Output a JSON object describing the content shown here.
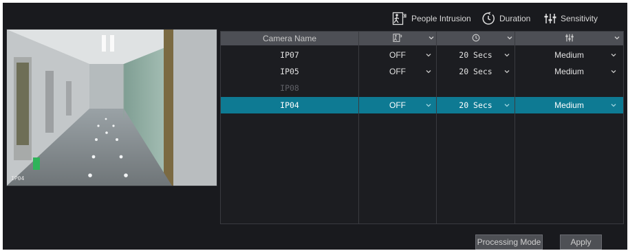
{
  "legend": {
    "intrusion_label": "People Intrusion",
    "duration_label": "Duration",
    "sensitivity_label": "Sensitivity"
  },
  "preview": {
    "camera_tag": "IP04"
  },
  "table": {
    "camera_header": "Camera Name",
    "rows": [
      {
        "camera": "IP07",
        "intrusion": "OFF",
        "duration": "20 Secs",
        "sensitivity": "Medium",
        "state": "normal"
      },
      {
        "camera": "IP05",
        "intrusion": "OFF",
        "duration": "20 Secs",
        "sensitivity": "Medium",
        "state": "normal"
      },
      {
        "camera": "IP08",
        "intrusion": "",
        "duration": "",
        "sensitivity": "",
        "state": "disabled"
      },
      {
        "camera": "IP04",
        "intrusion": "OFF",
        "duration": "20 Secs",
        "sensitivity": "Medium",
        "state": "selected"
      }
    ]
  },
  "buttons": {
    "processing_mode": "Processing Mode",
    "apply": "Apply"
  },
  "colors": {
    "background": "#191a1e",
    "header": "#4d4f55",
    "selected_row": "#0e7a93",
    "button": "#4e5055"
  }
}
